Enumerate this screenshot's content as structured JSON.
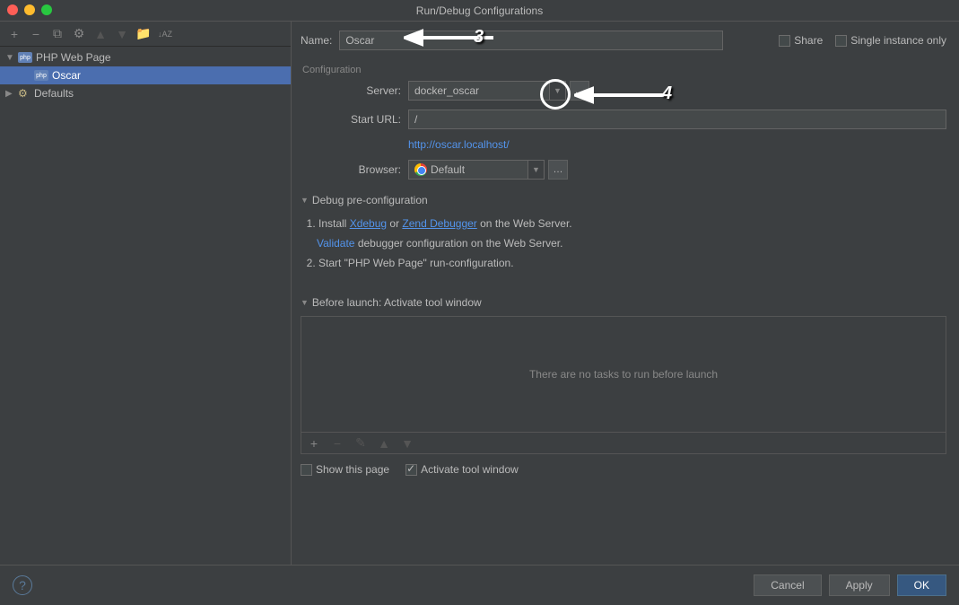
{
  "title": "Run/Debug Configurations",
  "sidebar": {
    "items": [
      {
        "label": "PHP Web Page",
        "expanded": true
      },
      {
        "label": "Oscar"
      },
      {
        "label": "Defaults",
        "expanded": false
      }
    ]
  },
  "labels": {
    "name": "Name:",
    "share": "Share",
    "single": "Single instance only",
    "configuration": "Configuration",
    "server": "Server:",
    "start_url": "Start URL:",
    "browser": "Browser:",
    "debug_pre": "Debug pre-configuration",
    "step1_a": "Install ",
    "xdebug": "Xdebug",
    "or": " or ",
    "zend": "Zend Debugger",
    "step1_b": " on the Web Server.",
    "validate": "Validate",
    "step2_b": " debugger configuration on the Web Server.",
    "step3": "Start \"PHP Web Page\" run-configuration.",
    "before_launch": "Before launch: Activate tool window",
    "no_tasks": "There are no tasks to run before launch",
    "show_page": "Show this page",
    "activate_window": "Activate tool window"
  },
  "values": {
    "name": "Oscar",
    "server": "docker_oscar",
    "start_url": "/",
    "url_preview": "http://oscar.localhost/",
    "browser": "Default"
  },
  "buttons": {
    "cancel": "Cancel",
    "apply": "Apply",
    "ok": "OK"
  },
  "annotations": {
    "n3": "3",
    "n4": "4"
  }
}
